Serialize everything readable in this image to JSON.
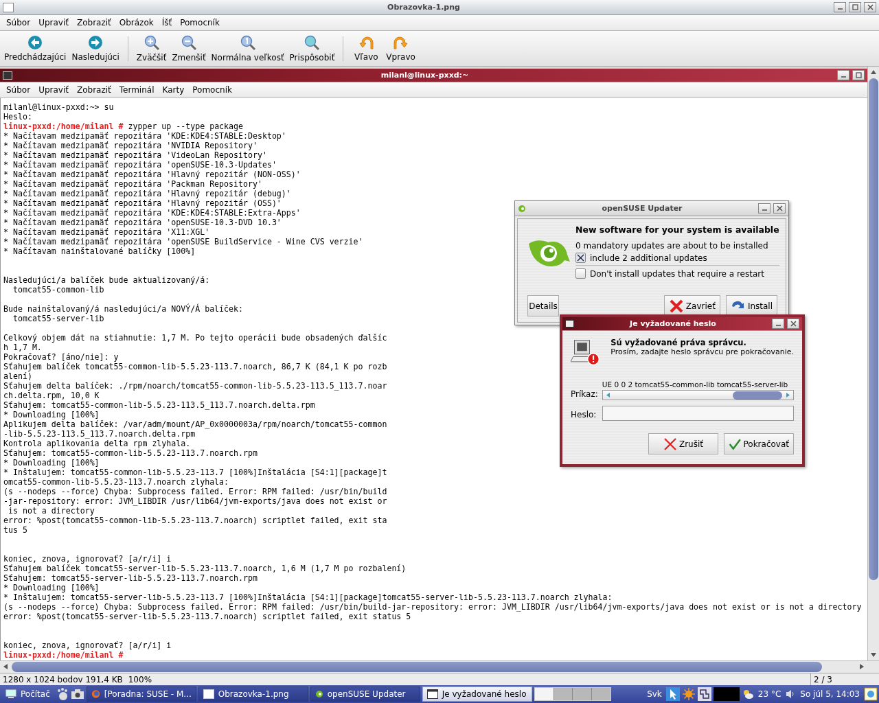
{
  "viewer": {
    "title": "Obrazovka-1.png",
    "menu": [
      "Súbor",
      "Upraviť",
      "Zobraziť",
      "Obrázok",
      "Íšť",
      "Pomocník"
    ],
    "toolbar_groups": [
      {
        "buttons": [
          {
            "label": "Predchádzajúci",
            "kind": "prev"
          },
          {
            "label": "Nasledujúci",
            "kind": "next"
          }
        ]
      },
      {
        "buttons": [
          {
            "label": "Zväčšiť",
            "kind": "zoom-in"
          },
          {
            "label": "Zmenšiť",
            "kind": "zoom-out"
          },
          {
            "label": "Normálna veľkosť",
            "kind": "zoom-actual"
          },
          {
            "label": "Prispôsobiť",
            "kind": "zoom-fit"
          }
        ]
      },
      {
        "buttons": [
          {
            "label": "Vľavo",
            "kind": "rotate-left"
          },
          {
            "label": "Vpravo",
            "kind": "rotate-right"
          }
        ]
      }
    ],
    "status": {
      "info": "1280 x 1024 bodov 191,4 KB",
      "zoom": "100%",
      "page": "2 / 3"
    }
  },
  "terminal": {
    "title": "milanl@linux-pxxd:~",
    "menu": [
      "Súbor",
      "Upraviť",
      "Zobraziť",
      "Terminál",
      "Karty",
      "Pomocník"
    ],
    "lines": [
      {
        "kind": "output",
        "text": "milanl@linux-pxxd:~> su"
      },
      {
        "kind": "output",
        "text": "Heslo:"
      },
      {
        "kind": "prompt",
        "prompt": "linux-pxxd:/home/milanl #",
        "command": "zypper up --type package"
      },
      {
        "kind": "output",
        "text": "* Načítavam medzipamäť repozitára 'KDE:KDE4:STABLE:Desktop'"
      },
      {
        "kind": "output",
        "text": "* Načítavam medzipamäť repozitára 'NVIDIA Repository'"
      },
      {
        "kind": "output",
        "text": "* Načítavam medzipamäť repozitára 'VideoLan Repository'"
      },
      {
        "kind": "output",
        "text": "* Načítavam medzipamäť repozitára 'openSUSE-10.3-Updates'"
      },
      {
        "kind": "output",
        "text": "* Načítavam medzipamäť repozitára 'Hlavný repozitár (NON-OSS)'"
      },
      {
        "kind": "output",
        "text": "* Načítavam medzipamäť repozitára 'Packman Repository'"
      },
      {
        "kind": "output",
        "text": "* Načítavam medzipamäť repozitára 'Hlavný repozitár (debug)'"
      },
      {
        "kind": "output",
        "text": "* Načítavam medzipamäť repozitára 'Hlavný repozitár (OSS)'"
      },
      {
        "kind": "output",
        "text": "* Načítavam medzipamäť repozitára 'KDE:KDE4:STABLE:Extra-Apps'"
      },
      {
        "kind": "output",
        "text": "* Načítavam medzipamäť repozitára 'openSUSE-10.3-DVD 10.3'"
      },
      {
        "kind": "output",
        "text": "* Načítavam medzipamäť repozitára 'X11:XGL'"
      },
      {
        "kind": "output",
        "text": "* Načítavam medzipamäť repozitára 'openSUSE BuildService - Wine CVS verzie'"
      },
      {
        "kind": "output",
        "text": "* Načítavam nainštalované balíčky [100%]"
      },
      {
        "kind": "blank"
      },
      {
        "kind": "blank"
      },
      {
        "kind": "output",
        "text": "Nasledujúci/a balíček bude aktualizovaný/á:"
      },
      {
        "kind": "output",
        "text": "  tomcat55-common-lib"
      },
      {
        "kind": "blank"
      },
      {
        "kind": "output",
        "text": "Bude nainštalovaný/á nasledujúci/a NOVÝ/Á balíček:"
      },
      {
        "kind": "output",
        "text": "  tomcat55-server-lib"
      },
      {
        "kind": "blank"
      },
      {
        "kind": "output",
        "text": "Celkový objem dát na stiahnutie: 1,7 M. Po tejto operácii bude obsadených ďalšíc"
      },
      {
        "kind": "output",
        "text": "h 1,7 M."
      },
      {
        "kind": "output",
        "text": "Pokračovať? [áno/nie]: y"
      },
      {
        "kind": "output",
        "text": "Sťahujem balíček tomcat55-common-lib-5.5.23-113.7.noarch, 86,7 K (84,1 K po rozb"
      },
      {
        "kind": "output",
        "text": "alení)"
      },
      {
        "kind": "output",
        "text": "Sťahujem delta balíček: ./rpm/noarch/tomcat55-common-lib-5.5.23-113.5_113.7.noar"
      },
      {
        "kind": "output",
        "text": "ch.delta.rpm, 10,0 K"
      },
      {
        "kind": "output",
        "text": "Sťahujem: tomcat55-common-lib-5.5.23-113.5_113.7.noarch.delta.rpm"
      },
      {
        "kind": "output",
        "text": "* Downloading [100%]"
      },
      {
        "kind": "output",
        "text": "Aplikujem delta balíček: /var/adm/mount/AP_0x0000003a/rpm/noarch/tomcat55-common"
      },
      {
        "kind": "output",
        "text": "-lib-5.5.23-113.5_113.7.noarch.delta.rpm"
      },
      {
        "kind": "output",
        "text": "Kontrola aplikovania delta rpm zlyhala."
      },
      {
        "kind": "output",
        "text": "Sťahujem: tomcat55-common-lib-5.5.23-113.7.noarch.rpm"
      },
      {
        "kind": "output",
        "text": "* Downloading [100%]"
      },
      {
        "kind": "output",
        "text": "* Inštalujem: tomcat55-common-lib-5.5.23-113.7 [100%]Inštalácia [S4:1][package]t"
      },
      {
        "kind": "output",
        "text": "omcat55-common-lib-5.5.23-113.7.noarch zlyhala:"
      },
      {
        "kind": "output",
        "text": "(s --nodeps --force) Chyba: Subprocess failed. Error: RPM failed: /usr/bin/build"
      },
      {
        "kind": "output",
        "text": "-jar-repository: error: JVM_LIBDIR /usr/lib64/jvm-exports/java does not exist or"
      },
      {
        "kind": "output",
        "text": " is not a directory"
      },
      {
        "kind": "output",
        "text": "error: %post(tomcat55-common-lib-5.5.23-113.7.noarch) scriptlet failed, exit sta"
      },
      {
        "kind": "output",
        "text": "tus 5"
      },
      {
        "kind": "blank"
      },
      {
        "kind": "blank"
      },
      {
        "kind": "output",
        "text": "koniec, znova, ignorovať? [a/r/i] i"
      },
      {
        "kind": "output",
        "text": "Sťahujem balíček tomcat55-server-lib-5.5.23-113.7.noarch, 1,6 M (1,7 M po rozbalení)"
      },
      {
        "kind": "output",
        "text": "Sťahujem: tomcat55-server-lib-5.5.23-113.7.noarch.rpm"
      },
      {
        "kind": "output",
        "text": "* Downloading [100%]"
      },
      {
        "kind": "output",
        "text": "* Inštalujem: tomcat55-server-lib-5.5.23-113.7 [100%]Inštalácia [S4:1][package]tomcat55-server-lib-5.5.23-113.7.noarch zlyhala:"
      },
      {
        "kind": "output",
        "text": "(s --nodeps --force) Chyba: Subprocess failed. Error: RPM failed: /usr/bin/build-jar-repository: error: JVM_LIBDIR /usr/lib64/jvm-exports/java does not exist or is not a directory"
      },
      {
        "kind": "output",
        "text": "error: %post(tomcat55-server-lib-5.5.23-113.7.noarch) scriptlet failed, exit status 5"
      },
      {
        "kind": "blank"
      },
      {
        "kind": "blank"
      },
      {
        "kind": "output",
        "text": "koniec, znova, ignorovať? [a/r/i] i"
      },
      {
        "kind": "prompt",
        "prompt": "linux-pxxd:/home/milanl #"
      }
    ]
  },
  "updater": {
    "title": "openSUSE Updater",
    "heading": "New software for your system is available",
    "summary": "0 mandatory updates are about to be installed",
    "options": [
      {
        "label": "include 2 additional updates",
        "checked": true
      },
      {
        "label": "Don't install updates that require a restart",
        "checked": false
      }
    ],
    "buttons": [
      {
        "label": "Details",
        "kind": "details"
      },
      {
        "label": "Zavrieť",
        "kind": "close"
      },
      {
        "label": "Install",
        "kind": "install"
      }
    ]
  },
  "password_dialog": {
    "title": "Je vyžadované heslo",
    "heading": "Sú vyžadované práva správcu.",
    "message": "Prosím, zadajte heslo správcu pre pokračovanie.",
    "command_label": "Príkaz:",
    "command": "UE 0 0 2 tomcat55-common-lib tomcat55-server-lib",
    "password_label": "Heslo:",
    "buttons": [
      {
        "label": "Zrušiť",
        "kind": "cancel"
      },
      {
        "label": "Pokračovať",
        "kind": "ok"
      }
    ]
  },
  "taskbar": {
    "start": "Počítač",
    "tasks": [
      {
        "label": "[Poradna: SUSE - M...",
        "kind": "browser",
        "selected": false
      },
      {
        "label": "Obrazovka-1.png",
        "kind": "image",
        "selected": false
      },
      {
        "label": "openSUSE Updater",
        "kind": "updater",
        "selected": false
      },
      {
        "label": "Je vyžadované heslo",
        "kind": "window",
        "selected": true
      }
    ],
    "keyboard": "Svk",
    "weather": "23 °C",
    "clock": "So júl 5, 14:03"
  }
}
